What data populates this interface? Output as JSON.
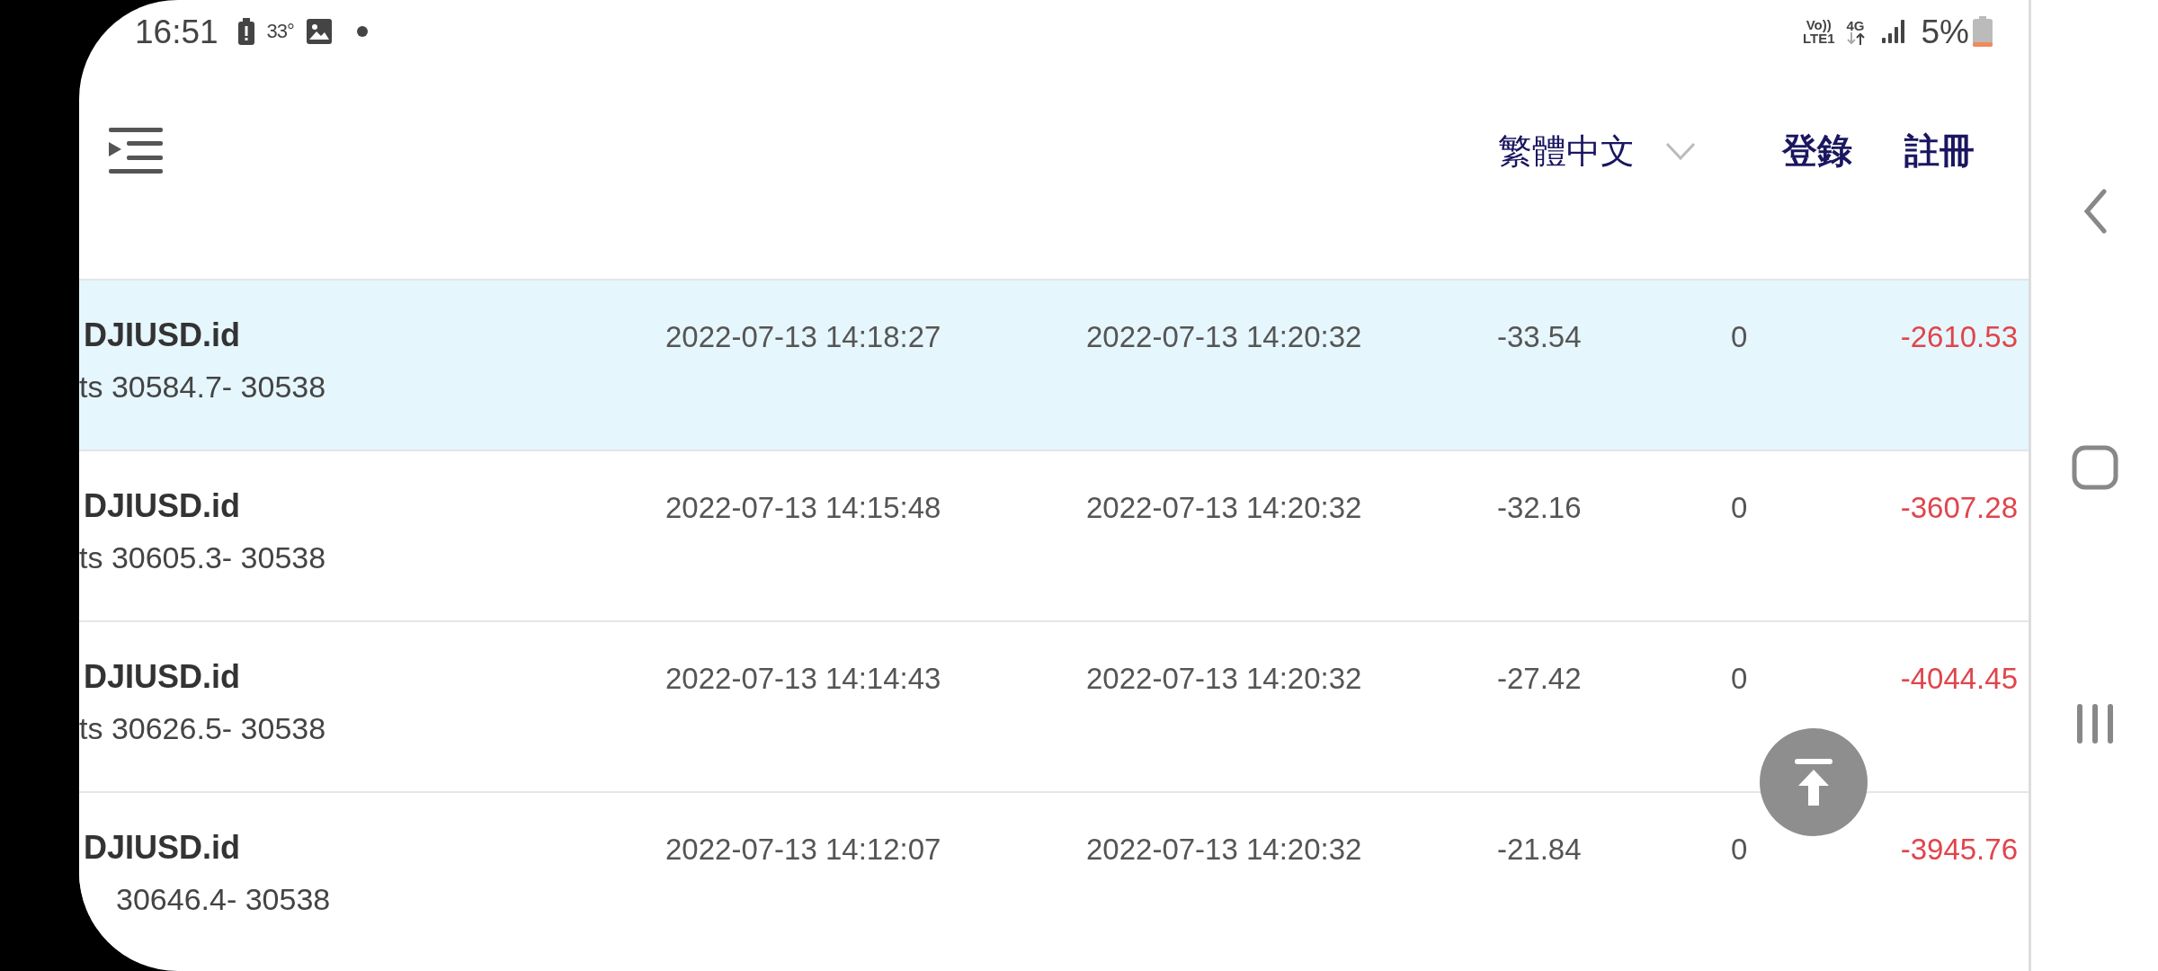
{
  "status_bar": {
    "time": "16:51",
    "temperature": "33°",
    "network_top": "Vo))",
    "network_bottom": "LTE1",
    "data_type": "4G",
    "battery": "5%"
  },
  "header": {
    "language": "繁體中文",
    "login": "登錄",
    "register": "註冊"
  },
  "rows": [
    {
      "symbol": "DJIUSD.id",
      "detail": "ts 30584.7- 30538",
      "column_2": "2022-07-13 14:18:27",
      "column_3": "2022-07-13 14:20:32",
      "column_4": "-33.54",
      "column_5": "0",
      "column_6": "-2610.53",
      "selected": true
    },
    {
      "symbol": "DJIUSD.id",
      "detail": "ts 30605.3- 30538",
      "column_2": "2022-07-13 14:15:48",
      "column_3": "2022-07-13 14:20:32",
      "column_4": "-32.16",
      "column_5": "0",
      "column_6": "-3607.28",
      "selected": false
    },
    {
      "symbol": "DJIUSD.id",
      "detail": "ts 30626.5- 30538",
      "column_2": "2022-07-13 14:14:43",
      "column_3": "2022-07-13 14:20:32",
      "column_4": "-27.42",
      "column_5": "0",
      "column_6": "-4044.45",
      "selected": false
    },
    {
      "symbol": "DJIUSD.id",
      "detail": "30646.4- 30538",
      "column_2": "2022-07-13 14:12:07",
      "column_3": "2022-07-13 14:20:32",
      "column_4": "-21.84",
      "column_5": "0",
      "column_6": "-3945.76",
      "selected": false
    }
  ]
}
